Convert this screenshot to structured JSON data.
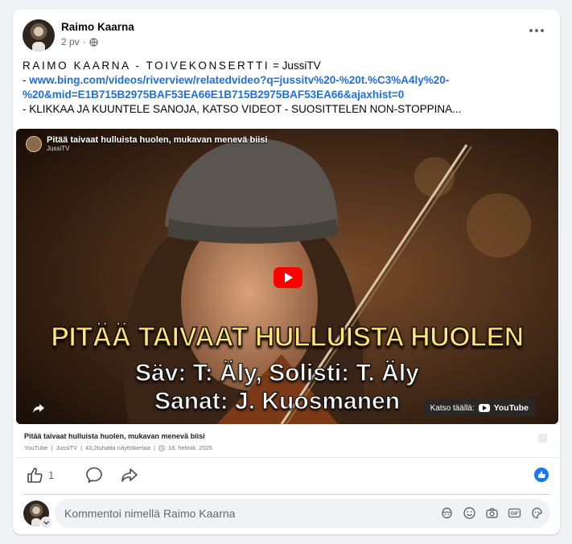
{
  "post": {
    "author": "Raimo Kaarna",
    "time": "2 pv",
    "separator": "·",
    "title_line_prefix": "RAIMO KAARNA - TOIVEKONSERTTI",
    "title_line_suffix": " = JussiTV",
    "link_prefix": "- ",
    "link_line1": "www.bing.com/videos/riverview/relatedvideo?q=jussitv%20-%20t.%C3%A4ly%20-",
    "link_line2": "%20&mid=E1B715B2975BAF53EA66E1B715B2975BAF53EA66&ajaxhist=0",
    "body_line": "- KLIKKAA JA KUUNTELE SANOJA, KATSO VIDEOT - SUOSITTELEN NON-STOPPINA..."
  },
  "video": {
    "top_title": "Pitää taivaat hulluista huolen, mukavan menevä biisi",
    "channel": "JussiTV",
    "overlay_line1": "PITÄÄ TAIVAAT HULLUISTA HUOLEN",
    "overlay_line2": "Säv: T: Äly, Solisti: T. Äly",
    "overlay_line3": "Sanat: J. Kuosmanen",
    "watch_on": "Katso täällä:",
    "watch_brand": "YouTube"
  },
  "caption": {
    "title": "Pitää taivaat hulluista huolen, mukavan menevä biisi",
    "source": "YouTube",
    "channel": "JussiTV",
    "views": "43,2tuhatta näyttökertaa",
    "date": "18. helmik. 2025",
    "sep": "|"
  },
  "actions": {
    "like_count": "1"
  },
  "comment": {
    "placeholder": "Kommentoi nimellä Raimo Kaarna"
  },
  "colors": {
    "link": "#216fdb",
    "accent": "#1877f2",
    "youtube_red": "#ff0000",
    "overlay_yellow": "#ffe57a"
  }
}
